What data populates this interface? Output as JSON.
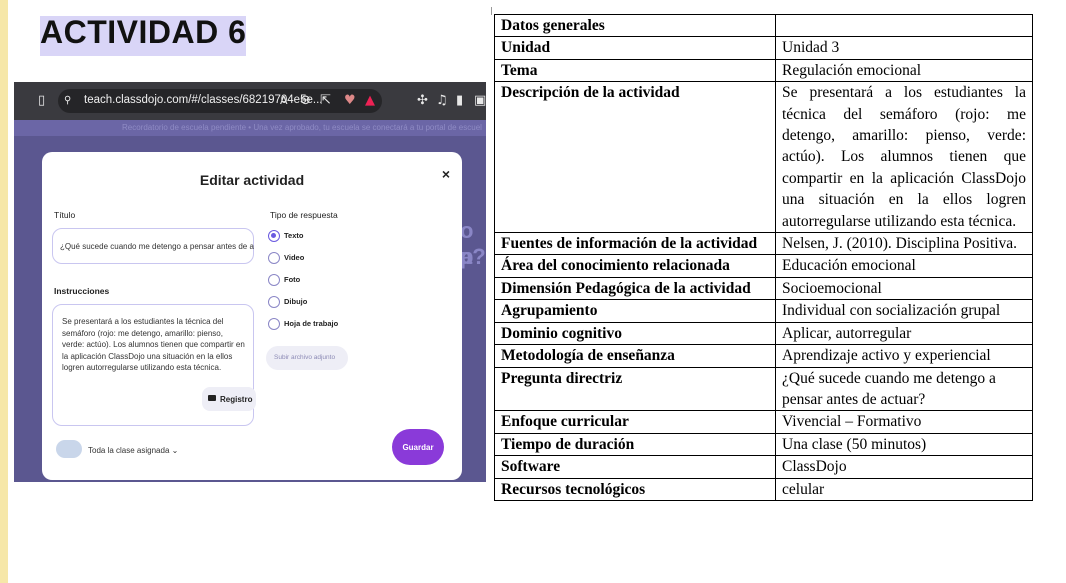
{
  "heading": "ACTIVIDAD 6",
  "browser": {
    "url": "teach.classdojo.com/#/classes/68219704e5e..."
  },
  "background": {
    "banner_text": "Recordatorio de escuela pendiente • Una vez aprobado, tu escuela se conectará a tu portal de escuela",
    "peek_text_1": "o p",
    "peek_text_2": "a?"
  },
  "modal": {
    "title": "Editar actividad",
    "close": "×",
    "title_label": "Título",
    "title_value": "¿Qué sucede cuando me detengo a pensar antes de a",
    "instructions_label": "Instrucciones",
    "instructions_value": "Se presentará a los estudiantes la técnica del semáforo (rojo: me detengo, amarillo: pienso, verde: actúo). Los alumnos tienen que compartir en la aplicación ClassDojo una situación en la ellos logren autorregularse utilizando esta técnica.",
    "record_button": "Registro",
    "response_type_label": "Tipo de respuesta",
    "response_options": [
      {
        "label": "Texto",
        "selected": true
      },
      {
        "label": "Video",
        "selected": false
      },
      {
        "label": "Foto",
        "selected": false
      },
      {
        "label": "Dibujo",
        "selected": false
      },
      {
        "label": "Hoja de trabajo",
        "selected": false
      }
    ],
    "attach_button": "Subir archivo adjunto",
    "assignee": "Toda la clase asignada",
    "save_button": "Guardar"
  },
  "table": {
    "rows": [
      {
        "key": "Datos generales",
        "value": ""
      },
      {
        "key": "Unidad",
        "value": "Unidad 3"
      },
      {
        "key": "Tema",
        "value": "Regulación emocional"
      },
      {
        "key": "Descripción de la actividad",
        "value": "Se presentará a los estudiantes la técnica del semáforo (rojo: me detengo, amarillo: pienso, verde: actúo). Los alumnos tienen que compartir en la aplicación ClassDojo una situación en la ellos logren autorregularse utilizando esta técnica."
      },
      {
        "key": "Fuentes de información de la actividad",
        "value": "Nelsen, J. (2010). Disciplina Positiva."
      },
      {
        "key": "Área del conocimiento relacionada",
        "value": "Educación emocional"
      },
      {
        "key": "Dimensión Pedagógica de la actividad",
        "value": "Socioemocional"
      },
      {
        "key": "Agrupamiento",
        "value": "Individual con socialización grupal"
      },
      {
        "key": "Dominio cognitivo",
        "value": "Aplicar, autorregular"
      },
      {
        "key": "Metodología de enseñanza",
        "value": "Aprendizaje activo y experiencial"
      },
      {
        "key": "Pregunta directriz",
        "value": "¿Qué sucede cuando me detengo a pensar antes de actuar?"
      },
      {
        "key": "Enfoque curricular",
        "value": "Vivencial – Formativo"
      },
      {
        "key": "Tiempo de duración",
        "value": "Una clase (50 minutos)"
      },
      {
        "key": "Software",
        "value": "ClassDojo"
      },
      {
        "key": "Recursos tecnológicos",
        "value": "celular"
      }
    ]
  }
}
